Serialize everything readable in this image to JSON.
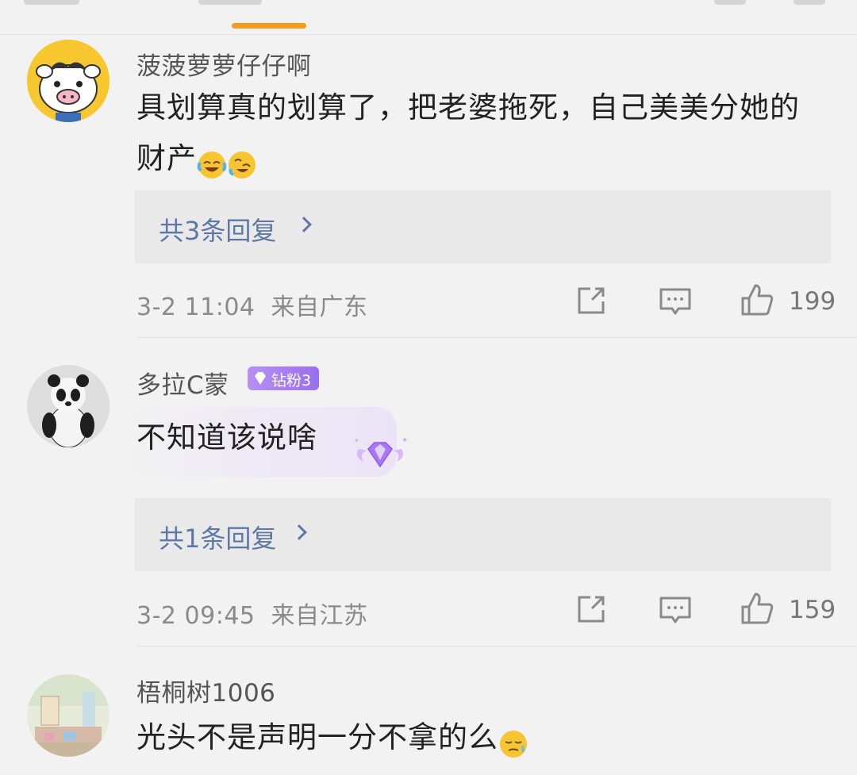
{
  "colors": {
    "accent": "#f79a20",
    "link": "#5d78a6",
    "badge": "#9a6ff0",
    "background": "#f2f2f2"
  },
  "comments": [
    {
      "username": "菠菠萝萝仔仔啊",
      "text": "具划算真的划算了，把老婆拖死，自己美美分她的财产",
      "emojis": [
        "laughing-tears-emoji",
        "rolling-laughing-emoji"
      ],
      "replies_label": "共3条回复",
      "timestamp": "3-2 11:04",
      "location": "来自广东",
      "likes": "199",
      "avatar": "cow-avatar"
    },
    {
      "username": "多拉C蒙",
      "badge_label": "钻粉3",
      "text": "不知道该说啥",
      "replies_label": "共1条回复",
      "timestamp": "3-2 09:45",
      "location": "来自江苏",
      "likes": "159",
      "avatar": "panda-avatar"
    },
    {
      "username": "梧桐树1006",
      "text": "光头不是声明一分不拿的么",
      "emojis": [
        "sweat-emoji"
      ],
      "avatar": "room-photo-avatar"
    }
  ]
}
